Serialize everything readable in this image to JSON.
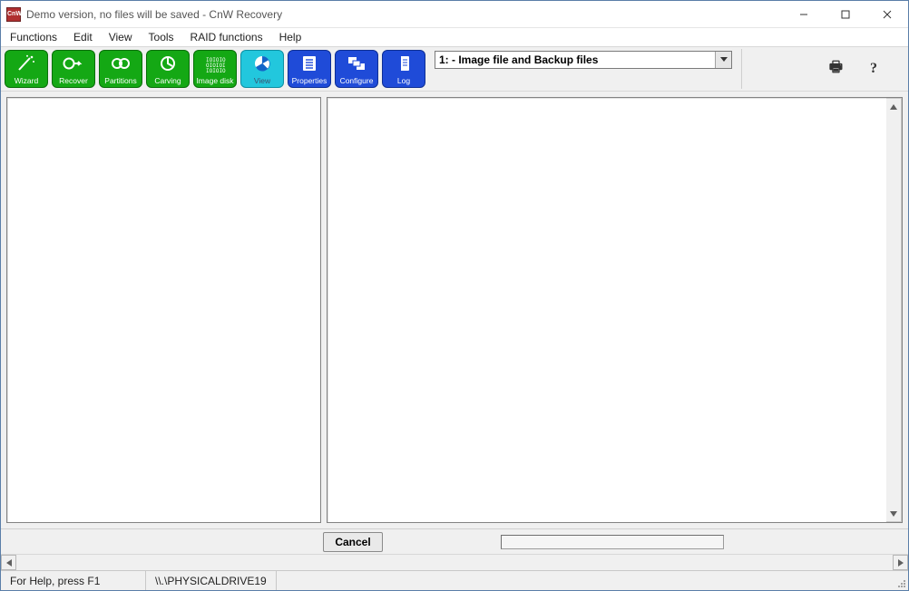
{
  "titlebar": {
    "icon_text": "CnW",
    "title": "Demo version, no files will be saved - CnW Recovery"
  },
  "menu": {
    "items": [
      "Functions",
      "Edit",
      "View",
      "Tools",
      "RAID functions",
      "Help"
    ]
  },
  "toolbar": {
    "buttons": [
      {
        "label": "Wizard",
        "color": "green",
        "icon": "wand-icon"
      },
      {
        "label": "Recover",
        "color": "green",
        "icon": "recover-icon"
      },
      {
        "label": "Partitions",
        "color": "green",
        "icon": "partitions-icon"
      },
      {
        "label": "Carving",
        "color": "green",
        "icon": "carving-icon"
      },
      {
        "label": "Image disk",
        "color": "green",
        "icon": "binary-icon"
      },
      {
        "label": "View",
        "color": "cyan",
        "icon": "pie-icon"
      },
      {
        "label": "Properties",
        "color": "blue",
        "icon": "properties-icon"
      },
      {
        "label": "Configure",
        "color": "blue",
        "icon": "configure-icon"
      },
      {
        "label": "Log",
        "color": "blue",
        "icon": "log-icon"
      }
    ],
    "drive_selected": "1: - Image file and Backup files",
    "print_icon": "print-icon",
    "help_icon": "help-icon"
  },
  "actions": {
    "cancel_label": "Cancel"
  },
  "statusbar": {
    "help_text": "For Help, press F1",
    "drive_path": "\\\\.\\PHYSICALDRIVE19"
  }
}
